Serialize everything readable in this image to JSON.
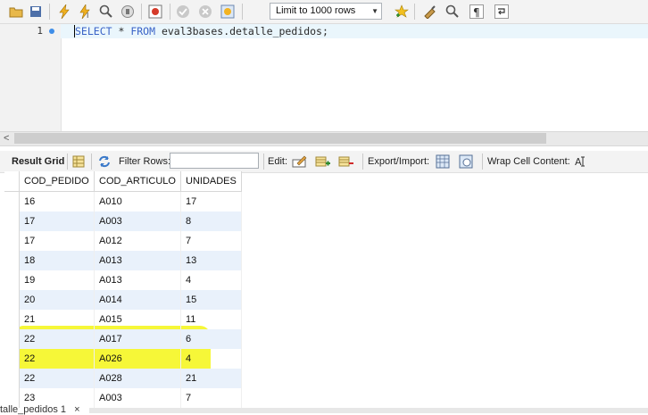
{
  "toolbar": {
    "limit_select": {
      "value": "Limit to 1000 rows"
    }
  },
  "editor": {
    "line_number": "1",
    "query_keyword_select": "SELECT",
    "query_star": " * ",
    "query_keyword_from": "FROM",
    "query_rest": " eval3bases.detalle_pedidos;"
  },
  "result_bar": {
    "result_grid_label": "Result Grid",
    "filter_rows_label": "Filter Rows:",
    "filter_rows_value": "",
    "edit_label": "Edit:",
    "export_import_label": "Export/Import:",
    "wrap_label": "Wrap Cell Content:"
  },
  "grid": {
    "columns": [
      "COD_PEDIDO",
      "COD_ARTICULO",
      "UNIDADES"
    ],
    "rows": [
      [
        "16",
        "A010",
        "17"
      ],
      [
        "17",
        "A003",
        "8"
      ],
      [
        "17",
        "A012",
        "7"
      ],
      [
        "18",
        "A013",
        "13"
      ],
      [
        "19",
        "A013",
        "4"
      ],
      [
        "20",
        "A014",
        "15"
      ],
      [
        "21",
        "A015",
        "11"
      ],
      [
        "22",
        "A017",
        "6"
      ],
      [
        "22",
        "A026",
        "4"
      ],
      [
        "22",
        "A028",
        "21"
      ],
      [
        "23",
        "A003",
        "7"
      ]
    ]
  },
  "bottom_tab": {
    "label": "talle_pedidos 1"
  },
  "colors": {
    "highlight": "#f4f500",
    "keyword": "#3a63c7",
    "row_alt": "#e9f1fb"
  }
}
